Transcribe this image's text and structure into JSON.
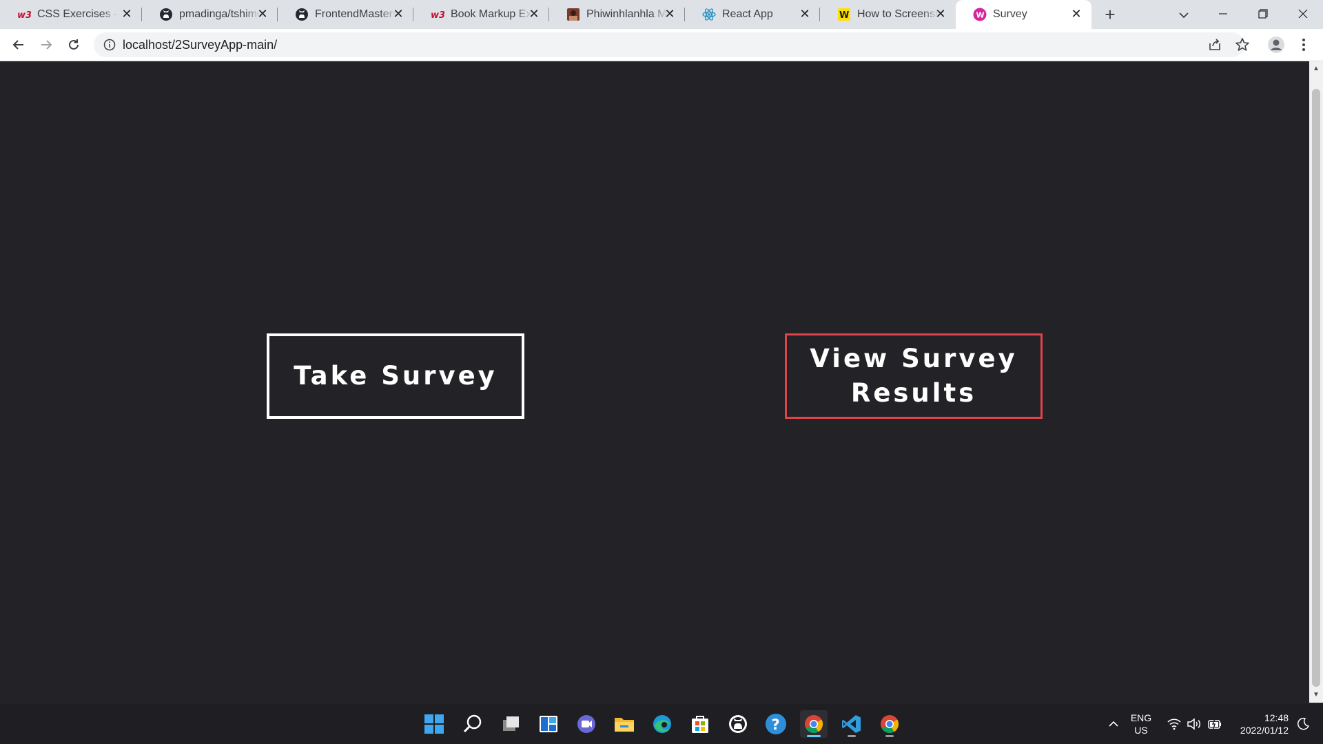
{
  "browser": {
    "tabs": [
      {
        "title": "CSS Exercises - Int",
        "favicon": "w3resource-icon",
        "active": false
      },
      {
        "title": "pmadinga/tshimo",
        "favicon": "github-icon",
        "active": false
      },
      {
        "title": "FrontendMasters/",
        "favicon": "github-icon",
        "active": false
      },
      {
        "title": "Book Markup Exe",
        "favicon": "w3resource-icon",
        "active": false
      },
      {
        "title": "Phiwinhlanhla Ma",
        "favicon": "photo-icon",
        "active": false
      },
      {
        "title": "React App",
        "favicon": "react-icon",
        "active": false
      },
      {
        "title": "How to Screensho",
        "favicon": "wikihow-icon",
        "active": false
      },
      {
        "title": "Survey",
        "favicon": "survey-icon",
        "active": true
      }
    ],
    "new_tab_label": "+",
    "close_glyph": "✕",
    "url": "localhost/2SurveyApp-main/"
  },
  "page": {
    "take_survey_label": "Take Survey",
    "view_results_label": "View Survey Results",
    "take_border_color": "#ffffff",
    "view_border_color": "#e0444a",
    "background_color": "#232227"
  },
  "taskbar": {
    "icons": [
      "windows-start-icon",
      "search-icon",
      "task-view-icon",
      "widgets-icon",
      "teams-chat-icon",
      "file-explorer-icon",
      "edge-icon",
      "store-icon",
      "github-desktop-icon",
      "help-icon",
      "chrome-icon",
      "vscode-icon",
      "chrome-icon"
    ],
    "language_line1": "ENG",
    "language_line2": "US",
    "time": "12:48",
    "date": "2022/01/12"
  }
}
